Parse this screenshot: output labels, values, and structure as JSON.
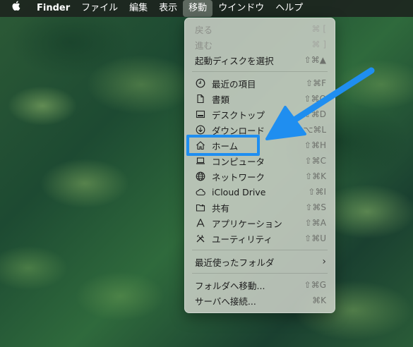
{
  "menubar": {
    "apple_icon": "apple-logo-icon",
    "items": [
      {
        "label": "Finder",
        "bold": true
      },
      {
        "label": "ファイル"
      },
      {
        "label": "編集"
      },
      {
        "label": "表示"
      },
      {
        "label": "移動",
        "active": true
      },
      {
        "label": "ウインドウ"
      },
      {
        "label": "ヘルプ"
      }
    ]
  },
  "go_menu": {
    "items": [
      {
        "label": "戻る",
        "shortcut": "⌘ [",
        "disabled": true
      },
      {
        "label": "進む",
        "shortcut": "⌘ ]",
        "disabled": true
      },
      {
        "label": "起動ディスクを選択",
        "shortcut": "⇧⌘▲"
      },
      {
        "label": "最近の項目",
        "shortcut": "⇧⌘F",
        "icon": "clock-icon"
      },
      {
        "label": "書類",
        "shortcut": "⇧⌘O",
        "icon": "document-icon"
      },
      {
        "label": "デスクトップ",
        "shortcut": "⇧⌘D",
        "icon": "desktop-icon"
      },
      {
        "label": "ダウンロード",
        "shortcut": "⌥⌘L",
        "icon": "download-icon"
      },
      {
        "label": "ホーム",
        "shortcut": "⇧⌘H",
        "icon": "home-icon",
        "highlighted": true
      },
      {
        "label": "コンピュータ",
        "shortcut": "⇧⌘C",
        "icon": "computer-icon"
      },
      {
        "label": "ネットワーク",
        "shortcut": "⇧⌘K",
        "icon": "network-globe-icon"
      },
      {
        "label": "iCloud Drive",
        "shortcut": "⇧⌘I",
        "icon": "cloud-icon"
      },
      {
        "label": "共有",
        "shortcut": "⇧⌘S",
        "icon": "shared-folder-icon"
      },
      {
        "label": "アプリケーション",
        "shortcut": "⇧⌘A",
        "icon": "applications-icon"
      },
      {
        "label": "ユーティリティ",
        "shortcut": "⇧⌘U",
        "icon": "utilities-icon"
      },
      {
        "label": "最近使ったフォルダ",
        "submenu": true
      },
      {
        "label": "フォルダへ移動...",
        "shortcut": "⇧⌘G"
      },
      {
        "label": "サーバへ接続...",
        "shortcut": "⌘K"
      }
    ]
  },
  "annotation": {
    "highlight_color": "#1f8ef0",
    "arrow_color": "#1f8ef0",
    "pointer_icon": "arrow-pointer-icon"
  }
}
